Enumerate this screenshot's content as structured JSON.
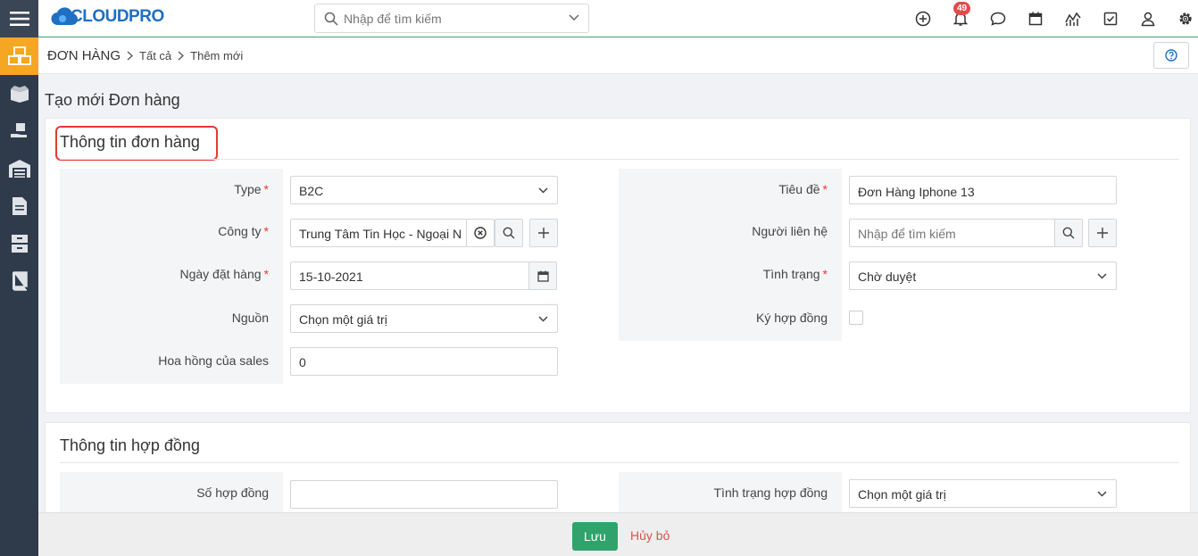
{
  "app": {
    "logo_text": "CLOUDPRO"
  },
  "search": {
    "placeholder": "Nhập để tìm kiếm"
  },
  "notifications": {
    "count": "49"
  },
  "breadcrumb": {
    "module": "ĐƠN HÀNG",
    "level1": "Tất cả",
    "level2": "Thêm mới"
  },
  "page": {
    "title": "Tạo mới Đơn hàng"
  },
  "section1": {
    "title": "Thông tin đơn hàng",
    "type": {
      "label": "Type",
      "value": "B2C"
    },
    "company": {
      "label": "Công ty",
      "value": "Trung Tâm Tin Học - Ngoại N"
    },
    "order_date": {
      "label": "Ngày đặt hàng",
      "value": "15-10-2021"
    },
    "source": {
      "label": "Nguồn",
      "value": "Chọn một giá trị"
    },
    "commission": {
      "label": "Hoa hồng của sales",
      "value": "0"
    },
    "subject": {
      "label": "Tiêu đề",
      "value": "Đơn Hàng Iphone 13"
    },
    "contact": {
      "label": "Người liên hệ",
      "placeholder": "Nhập để tìm kiếm"
    },
    "status": {
      "label": "Tình trạng",
      "value": "Chờ duyệt"
    },
    "signed": {
      "label": "Ký hợp đồng"
    }
  },
  "section2": {
    "title": "Thông tin hợp đồng",
    "contract_no": {
      "label": "Số hợp đồng",
      "value": ""
    },
    "contract_status": {
      "label": "Tình trạng hợp đồng",
      "value": "Chọn một giá trị"
    }
  },
  "footer": {
    "save": "Lưu",
    "cancel": "Hủy bỏ"
  },
  "colors": {
    "accent": "#2fa36b",
    "sidebar": "#2f3b4b",
    "sidebar_active": "#f5a623",
    "required": "#e53935",
    "logo": "#1f6fc2"
  }
}
